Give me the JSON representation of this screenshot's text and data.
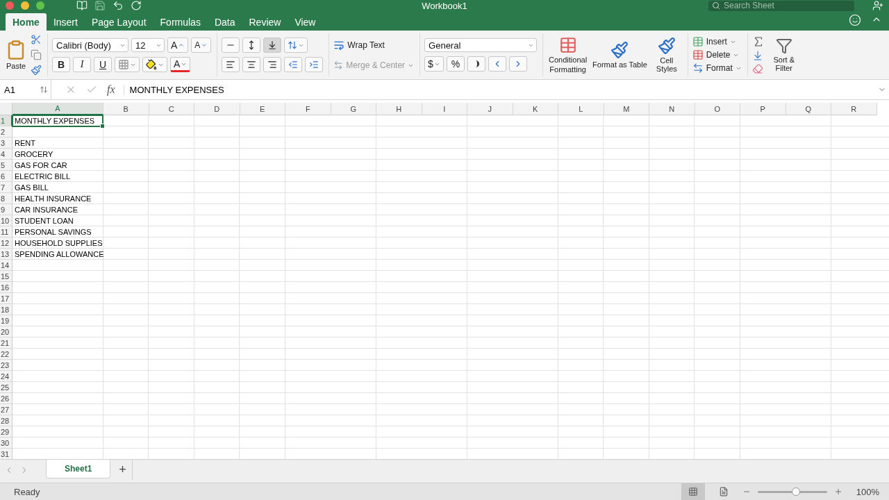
{
  "window": {
    "title": "Workbook1"
  },
  "search": {
    "placeholder": "Search Sheet"
  },
  "tabs": [
    {
      "label": "Home",
      "selected": true
    },
    {
      "label": "Insert",
      "selected": false
    },
    {
      "label": "Page Layout",
      "selected": false
    },
    {
      "label": "Formulas",
      "selected": false
    },
    {
      "label": "Data",
      "selected": false
    },
    {
      "label": "Review",
      "selected": false
    },
    {
      "label": "View",
      "selected": false
    }
  ],
  "ribbon": {
    "paste": "Paste",
    "font_name": "Calibri (Body)",
    "font_size": "12",
    "grow_font": "A",
    "shrink_font": "A",
    "bold": "B",
    "italic": "I",
    "underline": "U",
    "font_color": "A",
    "wrap_text": "Wrap Text",
    "merge_center": {
      "label": "Merge & Center",
      "disabled": true
    },
    "number_format": "General",
    "currency": "$",
    "percent": "%",
    "conditional_formatting": "Conditional Formatting",
    "format_as_table": "Format as Table",
    "cell_styles": "Cell Styles",
    "cells": [
      {
        "label": "Insert",
        "kind": "insert"
      },
      {
        "label": "Delete",
        "kind": "delete"
      },
      {
        "label": "Format",
        "kind": "format"
      }
    ],
    "sort_filter": "Sort & Filter"
  },
  "formula_bar": {
    "name_box": "A1",
    "fx": "fx",
    "formula": "MONTHLY EXPENSES"
  },
  "sheet": {
    "columns": [
      {
        "label": "A",
        "selected": true
      },
      {
        "label": "B",
        "selected": false
      },
      {
        "label": "C",
        "selected": false
      },
      {
        "label": "D",
        "selected": false
      },
      {
        "label": "E",
        "selected": false
      },
      {
        "label": "F",
        "selected": false
      },
      {
        "label": "G",
        "selected": false
      },
      {
        "label": "H",
        "selected": false
      },
      {
        "label": "I",
        "selected": false
      },
      {
        "label": "J",
        "selected": false
      },
      {
        "label": "K",
        "selected": false
      },
      {
        "label": "L",
        "selected": false
      },
      {
        "label": "M",
        "selected": false
      },
      {
        "label": "N",
        "selected": false
      },
      {
        "label": "O",
        "selected": false
      },
      {
        "label": "P",
        "selected": false
      },
      {
        "label": "Q",
        "selected": false
      },
      {
        "label": "R",
        "selected": false
      }
    ],
    "rows": [
      {
        "number": "1",
        "a": "MONTHLY EXPENSES",
        "selected": true
      },
      {
        "number": "2",
        "selected": false
      },
      {
        "number": "3",
        "a": "RENT",
        "selected": false
      },
      {
        "number": "4",
        "a": "GROCERY",
        "selected": false
      },
      {
        "number": "5",
        "a": "GAS FOR CAR",
        "selected": false
      },
      {
        "number": "6",
        "a": "ELECTRIC BILL",
        "selected": false
      },
      {
        "number": "7",
        "a": "GAS BILL",
        "selected": false
      },
      {
        "number": "8",
        "a": "HEALTH INSURANCE",
        "selected": false
      },
      {
        "number": "9",
        "a": "CAR INSURANCE",
        "selected": false
      },
      {
        "number": "10",
        "a": "STUDENT LOAN",
        "selected": false
      },
      {
        "number": "11",
        "a": "PERSONAL SAVINGS",
        "selected": false
      },
      {
        "number": "12",
        "a": "HOUSEHOLD SUPPLIES",
        "selected": false
      },
      {
        "number": "13",
        "a": "SPENDING ALLOWANCE",
        "selected": false
      },
      {
        "number": "14",
        "selected": false
      },
      {
        "number": "15",
        "selected": false
      },
      {
        "number": "16",
        "selected": false
      },
      {
        "number": "17",
        "selected": false
      },
      {
        "number": "18",
        "selected": false
      },
      {
        "number": "19",
        "selected": false
      },
      {
        "number": "20",
        "selected": false
      },
      {
        "number": "21",
        "selected": false
      },
      {
        "number": "22",
        "selected": false
      },
      {
        "number": "23",
        "selected": false
      },
      {
        "number": "24",
        "selected": false
      },
      {
        "number": "25",
        "selected": false
      },
      {
        "number": "26",
        "selected": false
      },
      {
        "number": "27",
        "selected": false
      },
      {
        "number": "28",
        "selected": false
      },
      {
        "number": "29",
        "selected": false
      },
      {
        "number": "30",
        "selected": false
      },
      {
        "number": "31",
        "selected": false
      }
    ]
  },
  "sheet_tabs": [
    {
      "label": "Sheet1",
      "selected": true
    }
  ],
  "add_sheet": "+",
  "status_bar": {
    "status": "Ready",
    "zoom": "100%",
    "level": 0.55
  }
}
